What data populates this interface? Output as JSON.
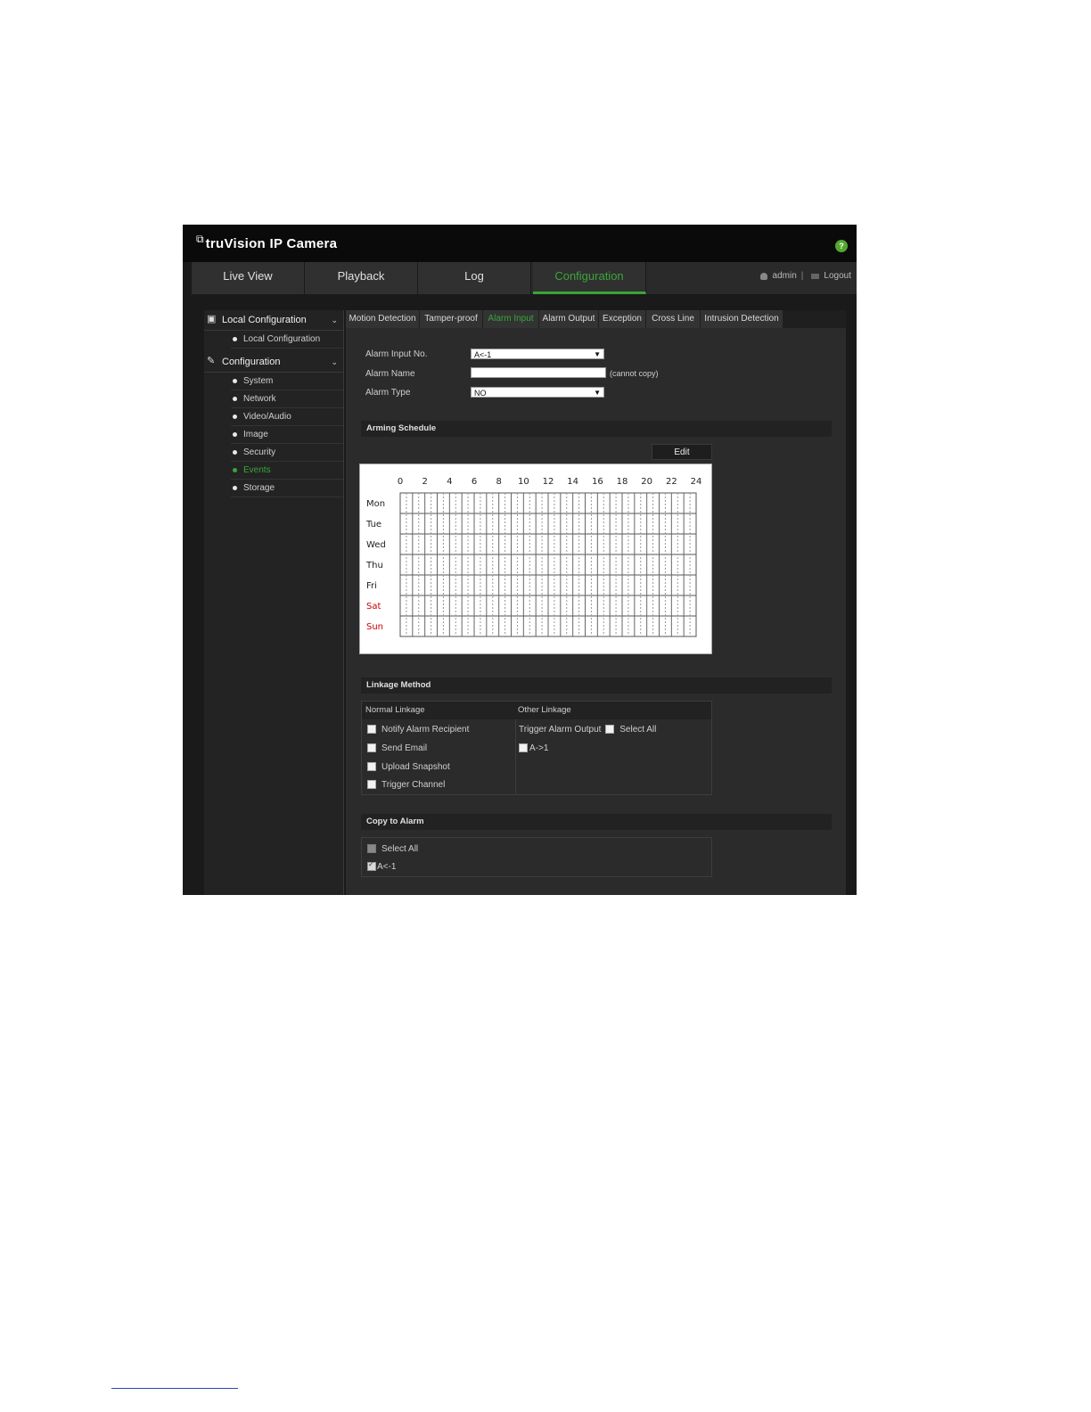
{
  "app": {
    "brand": "truVision  IP Camera",
    "help_icon": "help-icon"
  },
  "nav": {
    "tabs": [
      {
        "label": "Live View",
        "active": false
      },
      {
        "label": "Playback",
        "active": false
      },
      {
        "label": "Log",
        "active": false
      },
      {
        "label": "Configuration",
        "active": true
      }
    ],
    "user": "admin",
    "logout": "Logout"
  },
  "sidebar": {
    "sections": [
      {
        "label": "Local Configuration",
        "icon": "monitor-icon",
        "items": [
          "Local Configuration"
        ]
      },
      {
        "label": "Configuration",
        "icon": "wrench-icon",
        "items": [
          "System",
          "Network",
          "Video/Audio",
          "Image",
          "Security",
          "Events",
          "Storage"
        ],
        "active_item": "Events"
      }
    ]
  },
  "tabs": [
    {
      "label": "Motion Detection",
      "active": false
    },
    {
      "label": "Tamper-proof",
      "active": false
    },
    {
      "label": "Alarm Input",
      "active": true
    },
    {
      "label": "Alarm Output",
      "active": false
    },
    {
      "label": "Exception",
      "active": false
    },
    {
      "label": "Cross Line",
      "active": false
    },
    {
      "label": "Intrusion Detection",
      "active": false
    }
  ],
  "form": {
    "alarm_input_no_label": "Alarm Input No.",
    "alarm_input_no_value": "A<-1",
    "alarm_name_label": "Alarm Name",
    "alarm_name_value": "",
    "alarm_name_hint": "(cannot copy)",
    "alarm_type_label": "Alarm Type",
    "alarm_type_value": "NO"
  },
  "arming_schedule": {
    "title": "Arming Schedule",
    "edit_label": "Edit",
    "hours": [
      "0",
      "2",
      "4",
      "6",
      "8",
      "10",
      "12",
      "14",
      "16",
      "18",
      "20",
      "22",
      "24"
    ],
    "days": [
      "Mon",
      "Tue",
      "Wed",
      "Thu",
      "Fri",
      "Sat",
      "Sun"
    ],
    "weekend_color": "#cc0000",
    "weekday_color": "#222222"
  },
  "linkage": {
    "title": "Linkage Method",
    "normal_header": "Normal Linkage",
    "other_header": "Other Linkage",
    "normal_options": [
      "Notify Alarm Recipient",
      "Send Email",
      "Upload Snapshot",
      "Trigger Channel"
    ],
    "trigger_alarm_output_label": "Trigger Alarm Output",
    "select_all_label": "Select All",
    "output_option": "A->1"
  },
  "copy_to_alarm": {
    "title": "Copy to Alarm",
    "select_all_label": "Select All",
    "alarm_option": "A<-1"
  },
  "colors": {
    "accent_green": "#3aa53a"
  }
}
